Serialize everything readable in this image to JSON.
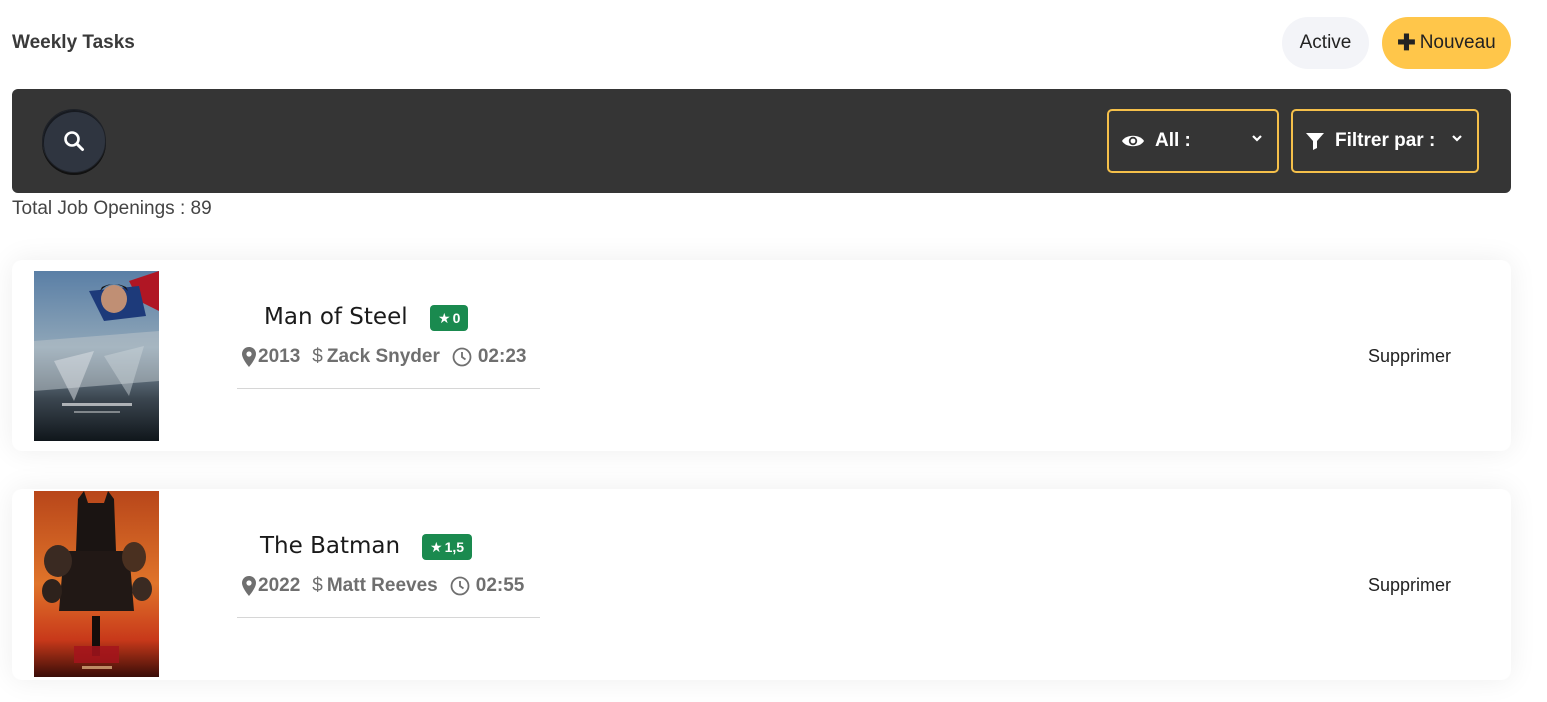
{
  "header": {
    "title": "Weekly Tasks",
    "active_label": "Active",
    "new_label": "Nouveau"
  },
  "toolbar": {
    "search_icon": "search-icon",
    "view_filter_label": "All :",
    "filter_label": "Filtrer par :"
  },
  "summary": {
    "total_text": "Total Job Openings : 89"
  },
  "movies": [
    {
      "title": "Man of Steel",
      "rating": "0",
      "year": "2013",
      "director": "Zack Snyder",
      "duration": "02:23",
      "delete_label": "Supprimer"
    },
    {
      "title": "The Batman",
      "rating": "1,5",
      "year": "2022",
      "director": "Matt Reeves",
      "duration": "02:55",
      "delete_label": "Supprimer"
    }
  ],
  "colors": {
    "accent": "#ffc64a",
    "toolbar_bg": "#353535",
    "rating_badge": "#1a8a4f",
    "active_bg": "#f3f4f8"
  }
}
